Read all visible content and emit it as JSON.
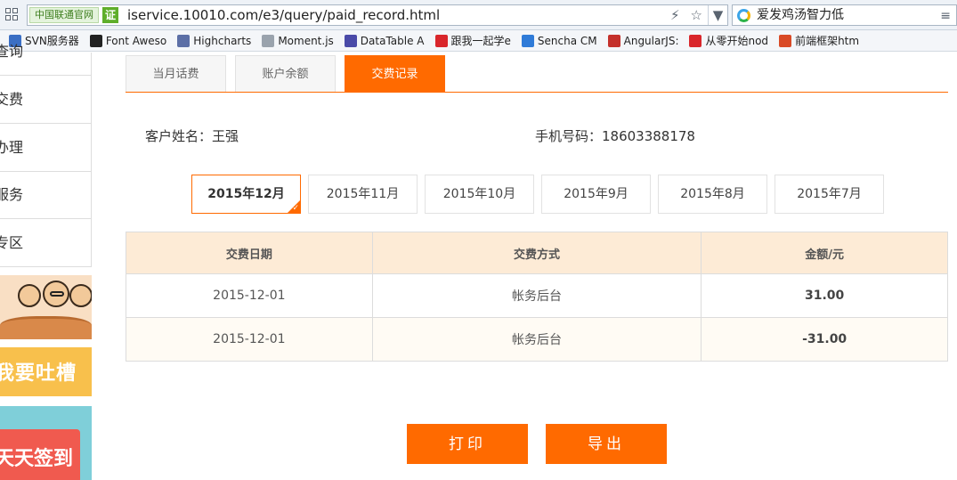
{
  "browser": {
    "site_badge": "中国联通官网",
    "ssl_badge": "证",
    "url": "iservice.10010.com/e3/query/paid_record.html",
    "search_text": "爱发鸡汤智力低",
    "icons": [
      "grid-icon",
      "lightning-icon",
      "star-icon",
      "chevron-down-icon",
      "search-engine-icon",
      "menu-icon"
    ]
  },
  "bookmarks": [
    {
      "label": "SVN服务器",
      "icon": "svn-icon",
      "color": "#3b6fc4"
    },
    {
      "label": "Font Aweso",
      "icon": "flag-icon",
      "color": "#222222"
    },
    {
      "label": "Highcharts",
      "icon": "highcharts-icon",
      "color": "#5c6fa6"
    },
    {
      "label": "Moment.js",
      "icon": "page-icon",
      "color": "#9aa3ad"
    },
    {
      "label": "DataTable A",
      "icon": "datatable-icon",
      "color": "#4a4aa8"
    },
    {
      "label": "跟我一起学e",
      "icon": "c-icon",
      "color": "#d9262b"
    },
    {
      "label": "Sencha CM",
      "icon": "sencha-icon",
      "color": "#2f7bd8"
    },
    {
      "label": "AngularJS:",
      "icon": "angular-icon",
      "color": "#c4302b"
    },
    {
      "label": "从零开始nod",
      "icon": "f-icon",
      "color": "#d9262b"
    },
    {
      "label": "前端框架htm",
      "icon": "hsu-icon",
      "color": "#d94a26"
    }
  ],
  "sidebar": {
    "items": [
      {
        "label": "查询"
      },
      {
        "label": "交费"
      },
      {
        "label": "办理"
      },
      {
        "label": "服务"
      },
      {
        "label": "专区"
      }
    ],
    "promo_complain": "我要吐槽",
    "promo_signin": "天天签到"
  },
  "tabs": [
    {
      "label": "当月话费",
      "active": false
    },
    {
      "label": "账户余额",
      "active": false
    },
    {
      "label": "交费记录",
      "active": true
    }
  ],
  "customer": {
    "name_label": "客户姓名：王强",
    "phone_label": "手机号码：18603388178"
  },
  "months": [
    {
      "label": "2015年12月",
      "active": true
    },
    {
      "label": "2015年11月",
      "active": false
    },
    {
      "label": "2015年10月",
      "active": false
    },
    {
      "label": "2015年9月",
      "active": false
    },
    {
      "label": "2015年8月",
      "active": false
    },
    {
      "label": "2015年7月",
      "active": false
    }
  ],
  "table": {
    "headers": [
      "交费日期",
      "交费方式",
      "金额/元"
    ],
    "rows": [
      {
        "date": "2015-12-01",
        "method": "帐务后台",
        "amount": "31.00"
      },
      {
        "date": "2015-12-01",
        "method": "帐务后台",
        "amount": "-31.00"
      }
    ]
  },
  "actions": {
    "print": "打印",
    "export": "导出"
  },
  "colors": {
    "accent": "#ff6a00",
    "header_bg": "#fdebd6"
  }
}
